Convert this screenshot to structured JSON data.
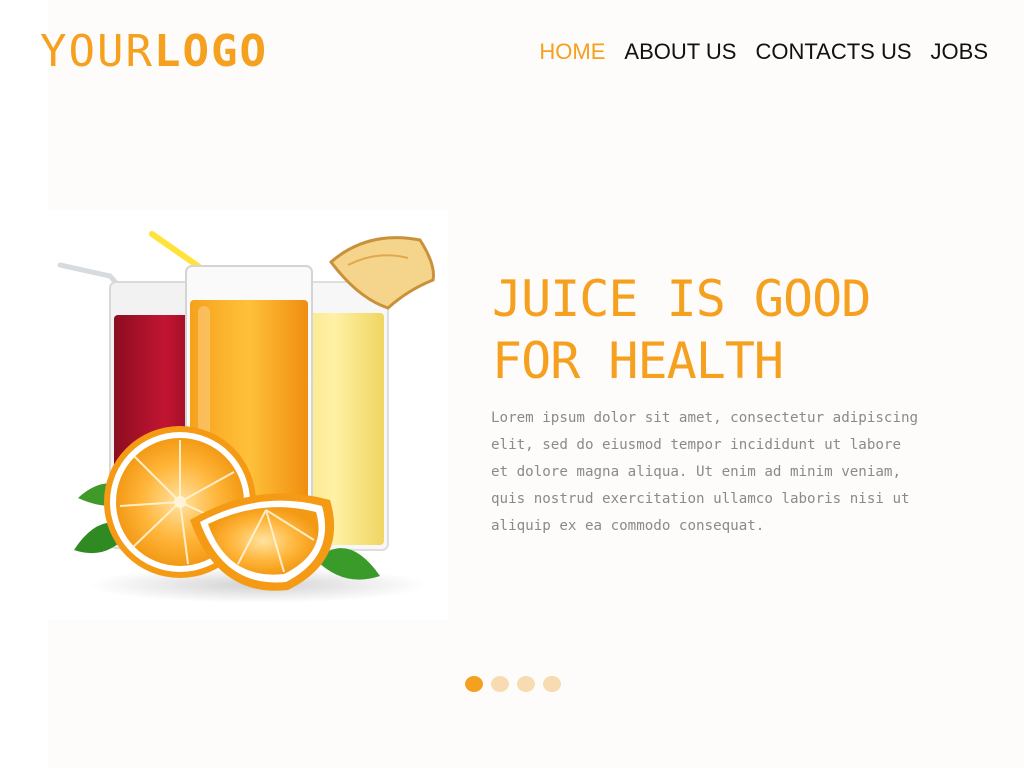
{
  "logo": {
    "part1": "YOUR",
    "part2": "LOGO"
  },
  "nav": {
    "items": [
      {
        "label": "HOME",
        "active": true
      },
      {
        "label": "ABOUT US",
        "active": false
      },
      {
        "label": "CONTACTS US",
        "active": false
      },
      {
        "label": "JOBS",
        "active": false
      }
    ]
  },
  "hero": {
    "headline_line1": "JUICE IS GOOD",
    "headline_line2": "FOR HEALTH",
    "body": "Lorem ipsum dolor sit amet, consectetur adipiscing elit, sed do eiusmod tempor incididunt ut labore et dolore magna aliqua. Ut enim ad minim veniam, quis nostrud exercitation ullamco laboris nisi ut aliquip ex ea commodo consequat.",
    "image_icon": "juice-glasses-oranges-image"
  },
  "slider": {
    "total": 4,
    "active_index": 0
  },
  "colors": {
    "accent": "#f5a01e",
    "accent_light": "#f6dcb0",
    "nav_text": "#111111",
    "body_text": "#8a8a8a"
  }
}
